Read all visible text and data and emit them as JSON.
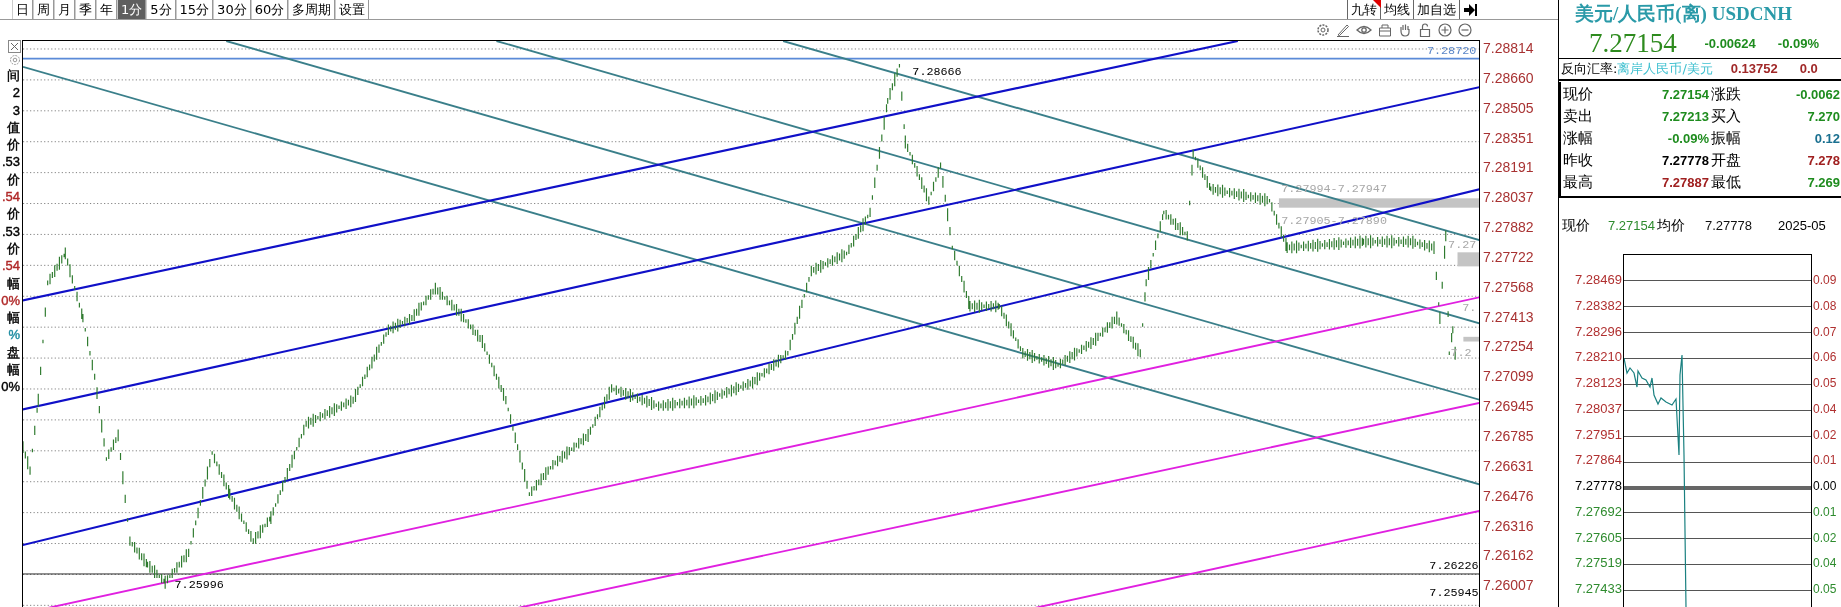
{
  "toolbar": {
    "periods": [
      {
        "label": "日",
        "selected": false
      },
      {
        "label": "周",
        "selected": false
      },
      {
        "label": "月",
        "selected": false
      },
      {
        "label": "季",
        "selected": false
      },
      {
        "label": "年",
        "selected": false
      },
      {
        "label": "1分",
        "selected": true
      },
      {
        "label": "5分",
        "selected": false
      },
      {
        "label": "15分",
        "selected": false
      },
      {
        "label": "30分",
        "selected": false
      },
      {
        "label": "60分",
        "selected": false
      },
      {
        "label": "多周期",
        "selected": false
      },
      {
        "label": "设置",
        "selected": false
      }
    ],
    "actions": [
      {
        "label": "九转",
        "flagged": true
      },
      {
        "label": "均线",
        "flagged": false
      },
      {
        "label": "加自选",
        "flagged": false
      }
    ]
  },
  "left_panel": {
    "items": [
      {
        "text": "间"
      },
      {
        "text": "2"
      },
      {
        "text": "3"
      },
      {
        "text": "值"
      },
      {
        "text": "价"
      },
      {
        "text": ".53"
      },
      {
        "text": "价"
      },
      {
        "text": ".54",
        "color": "#b02828"
      },
      {
        "text": "价"
      },
      {
        "text": ".53"
      },
      {
        "text": "价"
      },
      {
        "text": ".54",
        "color": "#b02828"
      },
      {
        "text": "幅"
      },
      {
        "text": "0%",
        "color": "#b02828"
      },
      {
        "text": "幅"
      },
      {
        "text": "%",
        "color": "#1a8aa0"
      },
      {
        "text": "盘"
      },
      {
        "text": "幅"
      },
      {
        "text": "0%"
      }
    ]
  },
  "chart": {
    "price_axis": [
      "7.28814",
      "7.28660",
      "7.28505",
      "7.28351",
      "7.28191",
      "7.28037",
      "7.27882",
      "7.27722",
      "7.27568",
      "7.27413",
      "7.27254",
      "7.27099",
      "7.26945",
      "7.26785",
      "7.26631",
      "7.26476",
      "7.26316",
      "7.26162",
      "7.26007"
    ],
    "annotations": [
      {
        "text": "7.28720",
        "kind": "line-price"
      },
      {
        "text": "7.28666",
        "kind": "extreme"
      },
      {
        "text": "7.27994-7.27947",
        "kind": "faded"
      },
      {
        "text": "7.27905-7.27890",
        "kind": "faded"
      },
      {
        "text": "7.27",
        "kind": "faded"
      },
      {
        "text": "7.",
        "kind": "faded"
      },
      {
        "text": "7.2",
        "kind": "faded"
      },
      {
        "text": "7.26226",
        "kind": "extreme"
      },
      {
        "text": "7.25945",
        "kind": "extreme"
      },
      {
        "text": "7.25996",
        "kind": "extreme"
      }
    ]
  },
  "quote": {
    "title": "美元/人民币(离) USDCNH",
    "price": "7.27154",
    "change": "-0.00624",
    "change_pct": "-0.09%",
    "reverse_label": "反向汇率:",
    "reverse_name": "离岸人民币/美元",
    "reverse_value": "0.13752",
    "reverse_pct": "0.0",
    "stats": [
      {
        "cells": [
          {
            "label": "现价",
            "value": "7.27154",
            "color": "#1e8c1e"
          },
          {
            "label": "涨跌",
            "value": "-0.0062",
            "color": "#1e8c1e"
          }
        ]
      },
      {
        "cells": [
          {
            "label": "卖出",
            "value": "7.27213",
            "color": "#1e8c1e"
          },
          {
            "label": "买入",
            "value": "7.270",
            "color": "#1e8c1e"
          }
        ]
      },
      {
        "cells": [
          {
            "label": "涨幅",
            "value": "-0.09%",
            "color": "#1e8c1e"
          },
          {
            "label": "振幅",
            "value": "0.12",
            "color": "#1a7090"
          }
        ]
      },
      {
        "cells": [
          {
            "label": "昨收",
            "value": "7.27778",
            "color": "#000000"
          },
          {
            "label": "开盘",
            "value": "7.278",
            "color": "#a02020"
          }
        ]
      },
      {
        "cells": [
          {
            "label": "最高",
            "value": "7.27887",
            "color": "#a02020"
          },
          {
            "label": "最低",
            "value": "7.269",
            "color": "#1e8c1e"
          }
        ]
      }
    ]
  },
  "intraday": {
    "price_label": "现价",
    "price": "7.27154",
    "avg_label": "均价",
    "avg": "7.27778",
    "date": "2025-05",
    "levels": [
      {
        "price": "7.28469",
        "pct": "0.09",
        "color": "#b03030",
        "baseline": false
      },
      {
        "price": "7.28382",
        "pct": "0.08",
        "color": "#b03030",
        "baseline": false
      },
      {
        "price": "7.28296",
        "pct": "0.07",
        "color": "#b03030",
        "baseline": false
      },
      {
        "price": "7.28210",
        "pct": "0.06",
        "color": "#b03030",
        "baseline": false
      },
      {
        "price": "7.28123",
        "pct": "0.05",
        "color": "#b03030",
        "baseline": false
      },
      {
        "price": "7.28037",
        "pct": "0.04",
        "color": "#b03030",
        "baseline": false
      },
      {
        "price": "7.27951",
        "pct": "0.02",
        "color": "#b03030",
        "baseline": false
      },
      {
        "price": "7.27864",
        "pct": "0.01",
        "color": "#b03030",
        "baseline": false
      },
      {
        "price": "7.27778",
        "pct": "0.00",
        "color": "#000000",
        "baseline": true
      },
      {
        "price": "7.27692",
        "pct": "0.01",
        "color": "#2e8b2e",
        "baseline": false
      },
      {
        "price": "7.27605",
        "pct": "0.02",
        "color": "#2e8b2e",
        "baseline": false
      },
      {
        "price": "7.27519",
        "pct": "0.04",
        "color": "#2e8b2e",
        "baseline": false
      },
      {
        "price": "7.27433",
        "pct": "0.05",
        "color": "#2e8b2e",
        "baseline": false
      }
    ]
  }
}
